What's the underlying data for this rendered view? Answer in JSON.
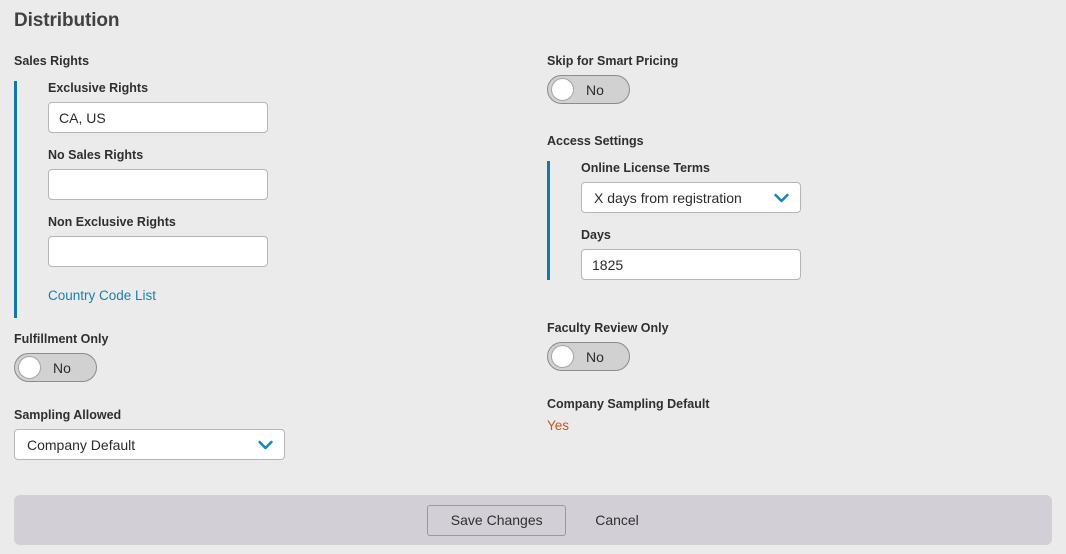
{
  "page": {
    "title": "Distribution"
  },
  "colors": {
    "accent_bar": "#1079a8",
    "link": "#1c7eb0",
    "chevron": "#1a87b8",
    "warning_value": "#d1521f",
    "page_background": "#ebebeb",
    "footer_background": "#d3cfd7"
  },
  "left_column": {
    "sales_rights": {
      "group_title": "Sales Rights",
      "fields": [
        {
          "label": "Exclusive Rights",
          "value": "CA, US",
          "placeholder": ""
        },
        {
          "label": "No Sales Rights",
          "value": "",
          "placeholder": ""
        },
        {
          "label": "Non Exclusive Rights",
          "value": "",
          "placeholder": ""
        }
      ],
      "link_label": "Country Code List"
    },
    "fulfillment_only": {
      "label": "Fulfillment Only",
      "toggle_value": "No",
      "toggle_state": "off"
    },
    "sampling_allowed": {
      "label": "Sampling Allowed",
      "selected": "Company Default",
      "chevron_icon": "chevron-down-icon"
    }
  },
  "right_column": {
    "skip_for_smart_pricing": {
      "label": "Skip for Smart Pricing",
      "toggle_value": "No",
      "toggle_state": "off"
    },
    "access_settings": {
      "group_title": "Access Settings",
      "online_license_terms": {
        "label": "Online License Terms",
        "selected": "X days from registration",
        "chevron_icon": "chevron-down-icon"
      },
      "days": {
        "label": "Days",
        "value": "1825",
        "placeholder": ""
      }
    },
    "faculty_review_only": {
      "label": "Faculty Review Only",
      "toggle_value": "No",
      "toggle_state": "off"
    },
    "company_sampling_default": {
      "label": "Company Sampling Default",
      "value": "Yes"
    }
  },
  "footer": {
    "save_label": "Save Changes",
    "cancel_label": "Cancel"
  }
}
